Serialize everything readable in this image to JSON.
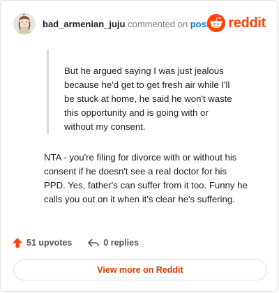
{
  "header": {
    "username": "bad_armenian_juju",
    "action_text": "commented on",
    "post_link": "post",
    "brand": "reddit"
  },
  "comment": {
    "quote_lines": [
      "But he argued saying I was just jealous",
      "because he'd get to get fresh air while I'll",
      "be stuck at home, he said he won't waste",
      "this opportunity and is going with or",
      "without my consent."
    ],
    "body_lines": [
      "NTA - you're filing for divorce with or without his",
      "consent if he doesn't see a real doctor for his",
      "PPD. Yes, father's can suffer from it too. Funny he",
      "calls you out on it when it's clear he's suffering."
    ]
  },
  "actions": {
    "upvotes": "51 upvotes",
    "replies": "0 replies"
  },
  "footer": {
    "view_more": "View more on Reddit"
  },
  "colors": {
    "brand": "#ff4500",
    "link": "#0079d3",
    "upvote": "#ff4500",
    "view_more": "#d93a00"
  },
  "icons": {
    "avatar": "avatar-drawing",
    "brand": "reddit-snoo-icon",
    "upvote": "upvote-arrow-icon",
    "reply": "reply-arrow-icon"
  }
}
